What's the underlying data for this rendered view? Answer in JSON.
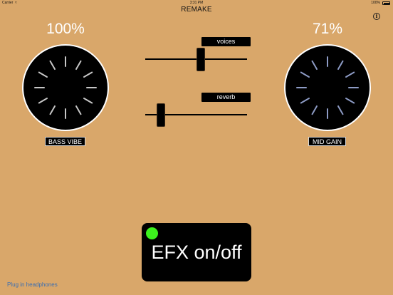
{
  "status_bar": {
    "carrier": "Carrier",
    "wifi_icon": "wifi-icon",
    "time": "3:31 PM",
    "battery_percent": "100%",
    "battery_icon": "battery-icon"
  },
  "header": {
    "title": "REMAKE",
    "info_icon": "info-icon",
    "info_glyph": "i"
  },
  "knobs": {
    "bass": {
      "label": "BASS VIBE",
      "percent_text": "100%",
      "value": 1.0
    },
    "mid": {
      "label": "MID GAIN",
      "percent_text": "71%",
      "value": 0.71
    }
  },
  "sliders": {
    "voices": {
      "label": "voices",
      "value": 0.55
    },
    "reverb": {
      "label": "reverb",
      "value": 0.12
    }
  },
  "efx": {
    "label": "EFX on/off",
    "on": true,
    "led_color": "#3cf21d"
  },
  "footer": {
    "hint": "Plug in headphones",
    "hint_color": "#3d6fb0"
  },
  "colors": {
    "background": "#d9a76a",
    "percent_text": "#ffffff",
    "bass_tick": "#c7c7c7",
    "mid_tick": "#8e9cc6",
    "knob_body": "#000000",
    "knob_ring": "#ffffff"
  }
}
